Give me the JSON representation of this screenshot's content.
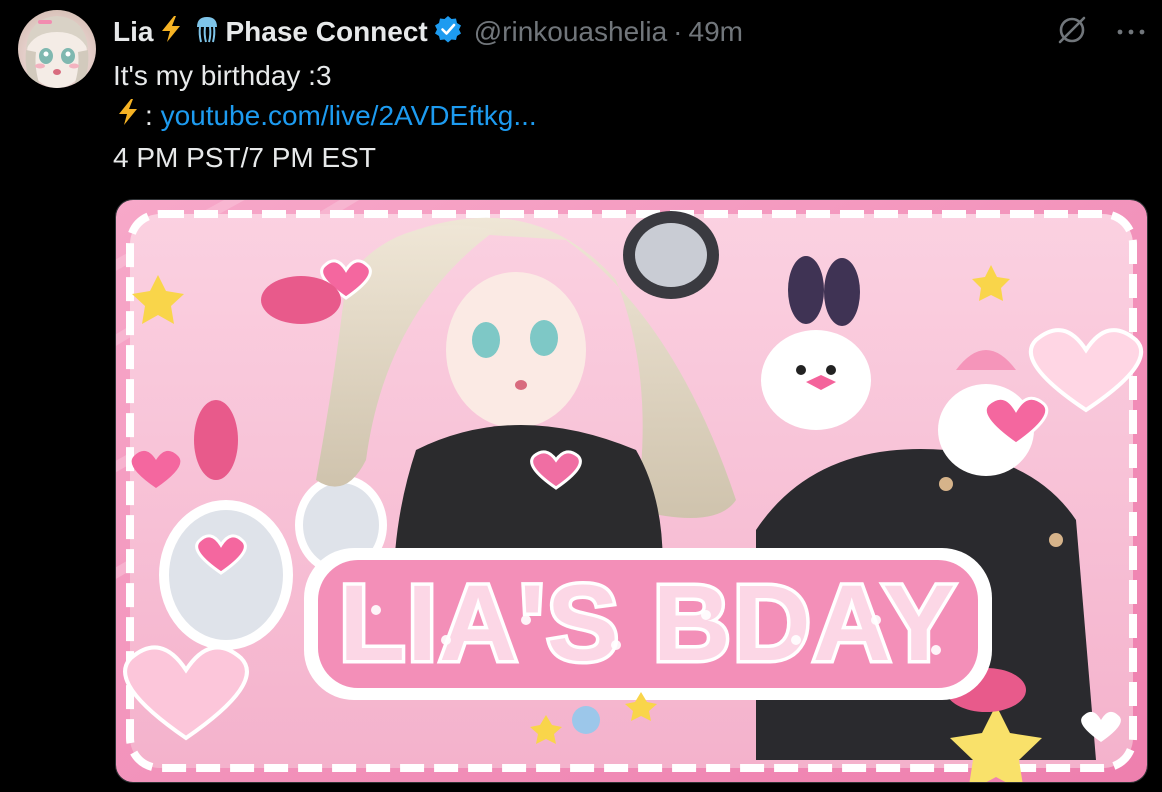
{
  "author": {
    "display_name": "Lia",
    "affiliation": "Phase Connect",
    "handle": "@rinkouashelia",
    "separator": "·",
    "time": "49m",
    "verified_color": "#1d9bf0"
  },
  "actions": {
    "grok_icon": "grok-icon",
    "more_label": "···"
  },
  "body": {
    "line1": "It's my birthday :3",
    "link_prefix": ":",
    "link_text": "youtube.com/live/2AVDEftkg...",
    "line3": "4 PM PST/7 PM EST"
  },
  "media": {
    "banner_title": "LIA'S BDAY",
    "alt_description": "pink birthday illustration"
  },
  "colors": {
    "background": "#000000",
    "text": "#e7e9ea",
    "muted": "#71767b",
    "link": "#1d9bf0",
    "banner_pink": "#f38fb8"
  }
}
